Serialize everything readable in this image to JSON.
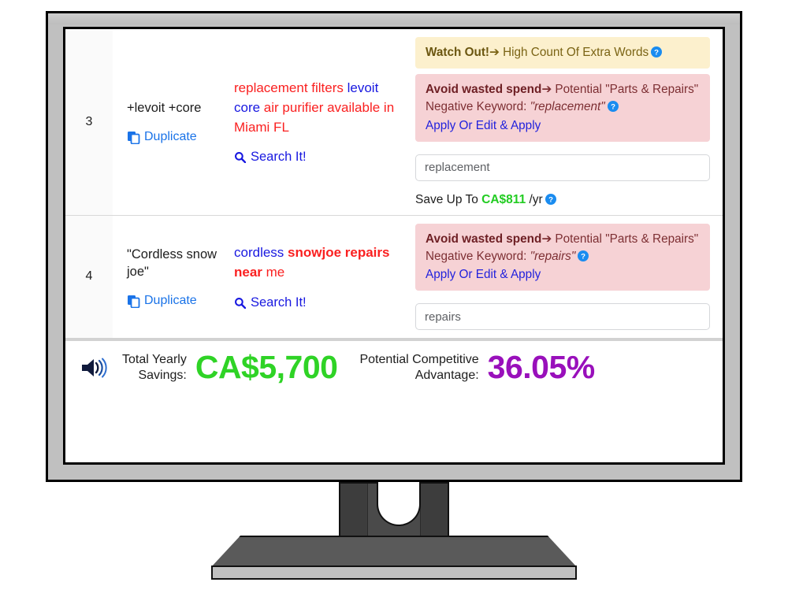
{
  "rows": [
    {
      "index": "3",
      "keyword": "+levoit +core",
      "duplicate_label": "Duplicate",
      "search_label": "Search It!",
      "query_parts": [
        {
          "text": "replacement filters ",
          "color": "red",
          "bold": false
        },
        {
          "text": "levoit core ",
          "color": "blue",
          "bold": false
        },
        {
          "text": "air purifier available in Miami FL",
          "color": "red",
          "bold": false
        }
      ],
      "alerts": [
        {
          "type": "warning",
          "prefix": "Watch Out!",
          "arrow": "➔",
          "body": "High Count Of Extra Words",
          "has_help": true
        },
        {
          "type": "danger",
          "prefix": "Avoid wasted spend",
          "arrow": "➔",
          "body": "Potential \"Parts & Repairs\" Negative Keyword:",
          "emphasis": "\"replacement\"",
          "has_help": true,
          "action_label": "Apply Or Edit & Apply"
        }
      ],
      "input_value": "replacement",
      "input_placeholder": "Negative keyword",
      "savings": {
        "prefix": "Save Up To",
        "amount": "CA$811",
        "suffix": "/yr",
        "has_help": true
      }
    },
    {
      "index": "4",
      "keyword": "\"Cordless snow joe\"",
      "duplicate_label": "Duplicate",
      "search_label": "Search It!",
      "query_parts": [
        {
          "text": "cordless ",
          "color": "blue",
          "bold": false
        },
        {
          "text": "snowjoe repairs ",
          "color": "red",
          "bold": true
        },
        {
          "text": "near ",
          "color": "red",
          "bold": true
        },
        {
          "text": "me",
          "color": "red",
          "bold": false
        }
      ],
      "alerts": [
        {
          "type": "danger",
          "prefix": "Avoid wasted spend",
          "arrow": "➔",
          "body": "Potential \"Parts & Repairs\" Negative Keyword:",
          "emphasis": "\"repairs\"",
          "has_help": true,
          "action_label": "Apply Or Edit & Apply"
        }
      ],
      "input_value": "repairs",
      "input_placeholder": "Negative keyword",
      "savings": null
    }
  ],
  "footer": {
    "speaker_icon": "speaker-icon",
    "savings": {
      "label_line1": "Total Yearly",
      "label_line2": "Savings:",
      "value": "CA$5,700",
      "color": "#2fd326"
    },
    "advantage": {
      "label_line1": "Potential Competitive",
      "label_line2": "Advantage:",
      "value": "36.05%",
      "color": "#9910bb"
    }
  },
  "icons": {
    "duplicate": "duplicate-icon",
    "search": "search-icon",
    "help": "help-icon"
  },
  "colors": {
    "warning_bg": "#fcf0cd",
    "warning_text": "#7a6314",
    "danger_bg": "#f6d2d5",
    "danger_text": "#7d2f33",
    "link_blue": "#2222dd",
    "query_red": "#fa2020",
    "query_blue": "#1818e0",
    "green": "#2fd326",
    "purple": "#9910bb",
    "bezel": "#c0c0c0"
  }
}
